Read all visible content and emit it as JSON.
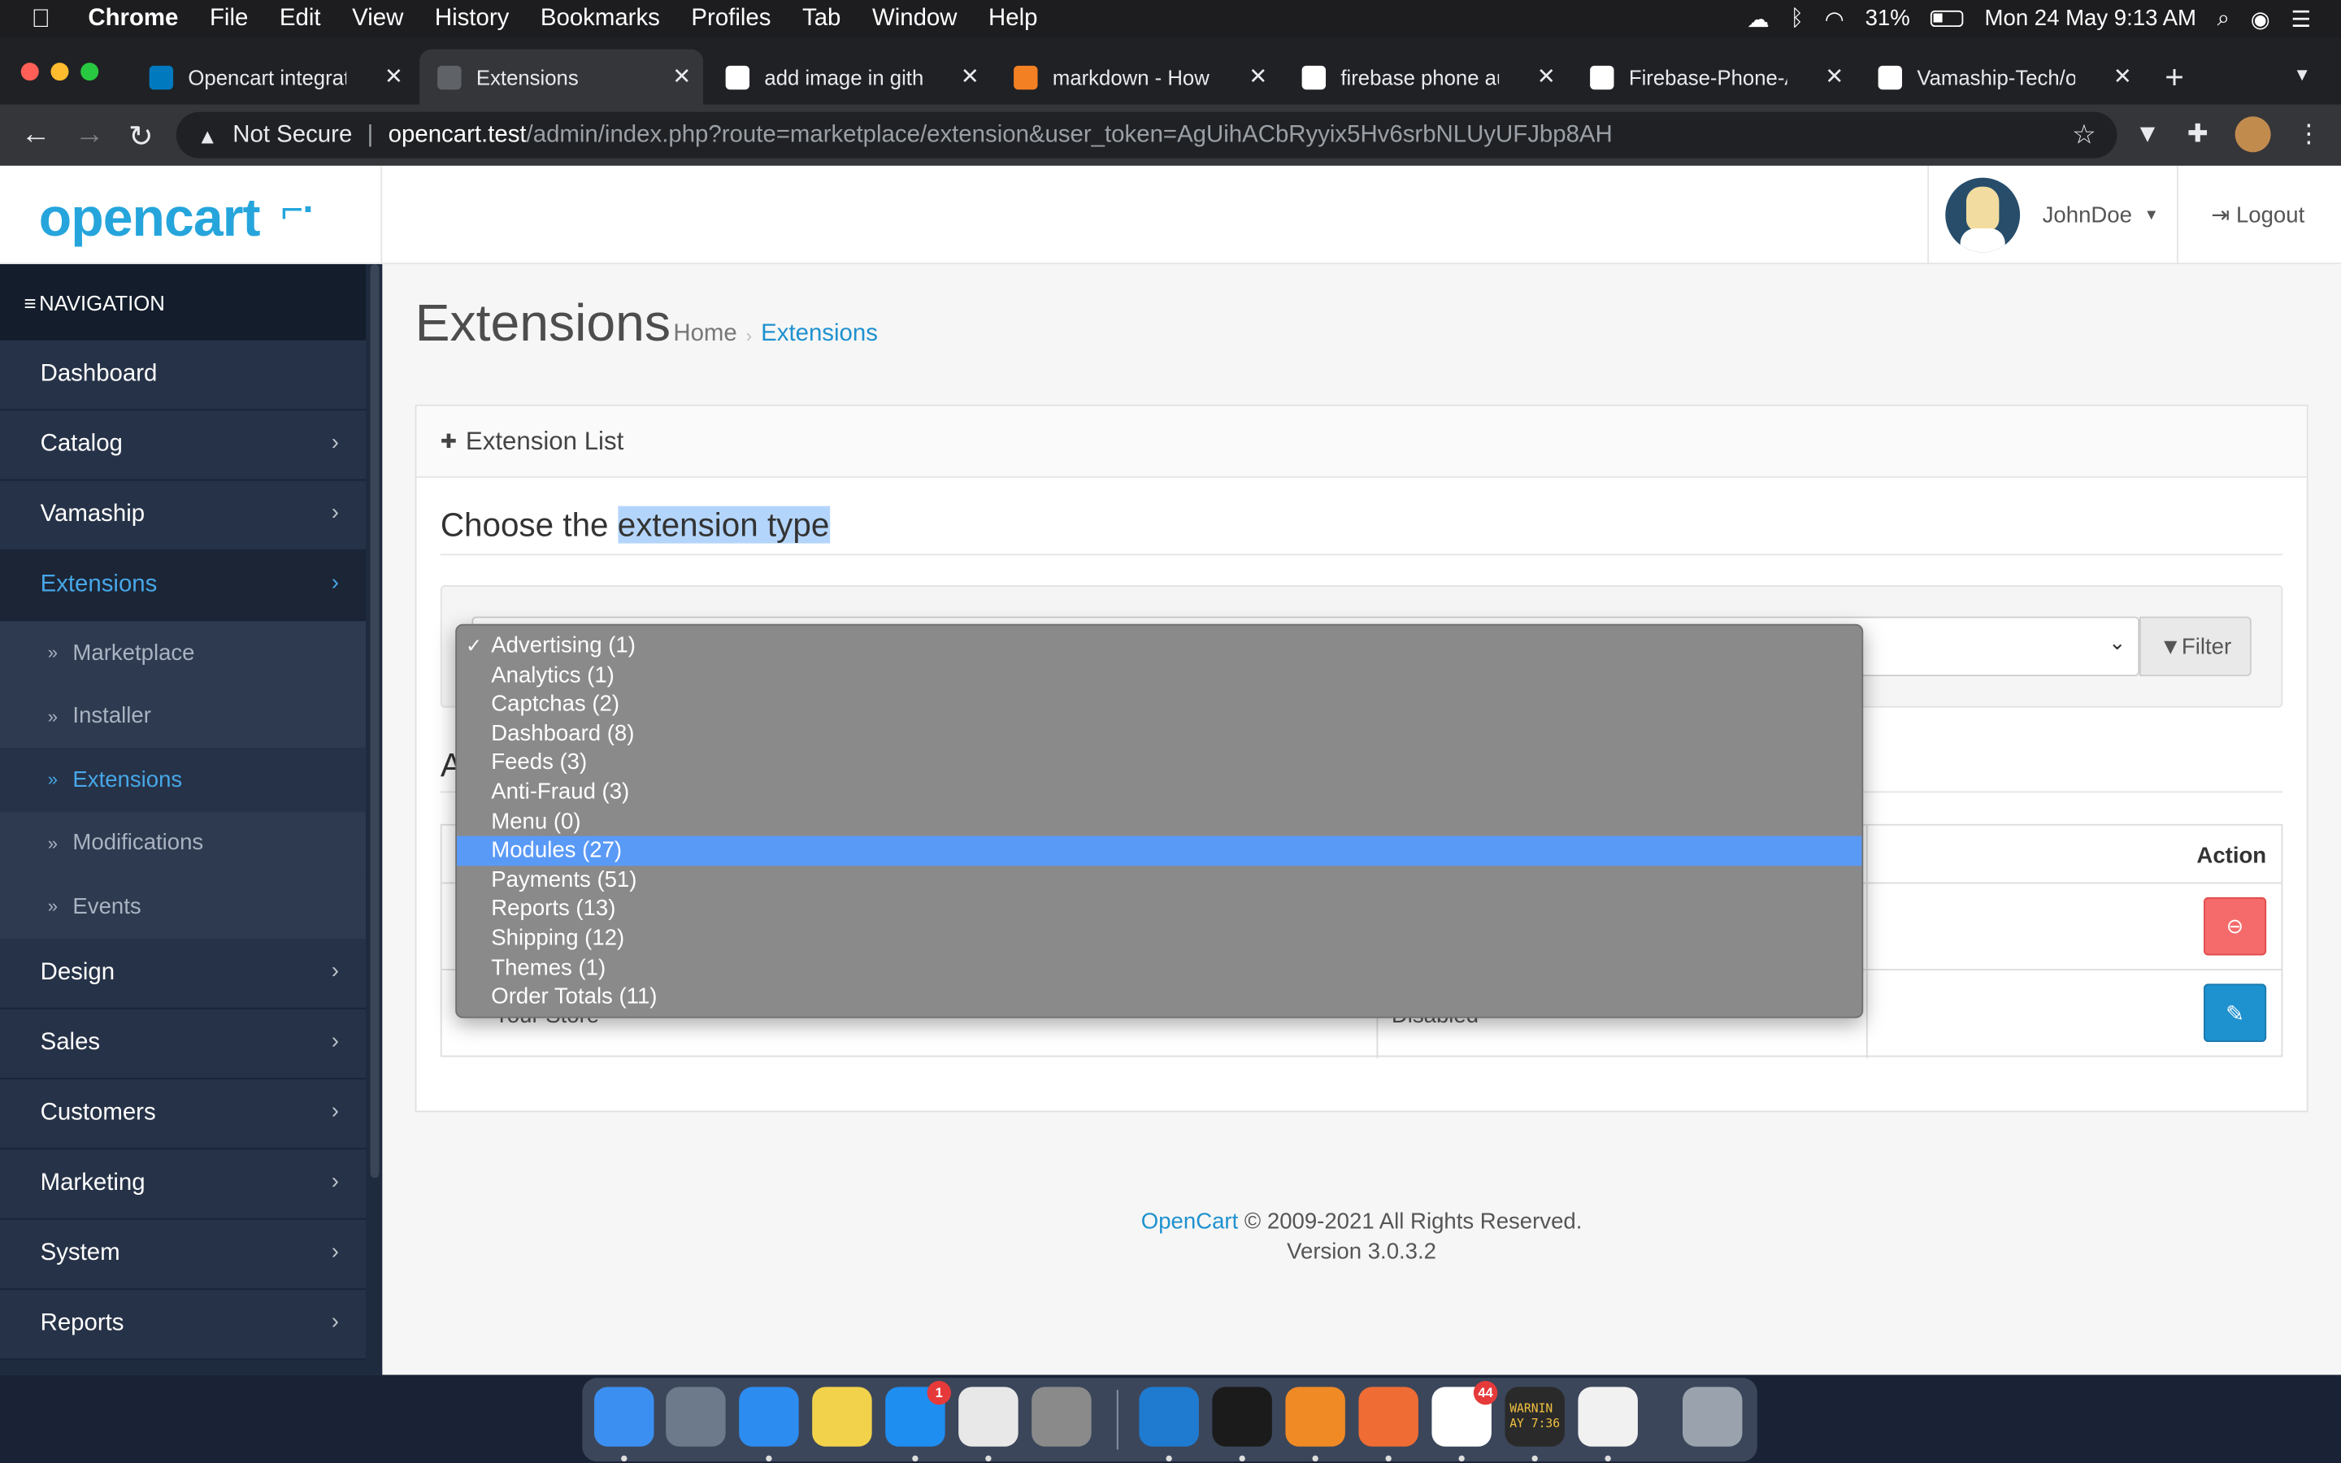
{
  "menubar": {
    "app": "Chrome",
    "menus": [
      "File",
      "Edit",
      "View",
      "History",
      "Bookmarks",
      "Profiles",
      "Tab",
      "Window",
      "Help"
    ],
    "battery": "31%",
    "clock": "Mon 24 May  9:13 AM"
  },
  "tabs": [
    {
      "title": "Opencart integratio",
      "favicon": "trello-icon",
      "color": "#0079bf"
    },
    {
      "title": "Extensions",
      "favicon": "globe-icon",
      "color": "#5f6368"
    },
    {
      "title": "add image in github",
      "favicon": "google-icon",
      "color": "#ffffff"
    },
    {
      "title": "markdown - How to",
      "favicon": "stackoverflow-icon",
      "color": "#f48024"
    },
    {
      "title": "firebase phone auth",
      "favicon": "google-icon",
      "color": "#ffffff"
    },
    {
      "title": "Firebase-Phone-Au",
      "favicon": "github-icon",
      "color": "#ffffff"
    },
    {
      "title": "Vamaship-Tech/ope",
      "favicon": "github-icon",
      "color": "#ffffff"
    }
  ],
  "address": {
    "security": "Not Secure",
    "host": "opencart.test",
    "path": "/admin/index.php?route=marketplace/extension&user_token=AgUihACbRyyix5Hv6srbNLUyUFJbp8AH"
  },
  "header": {
    "logo": "opencart",
    "user_name": "JohnDoe",
    "logout": "Logout"
  },
  "sidebar": {
    "heading": "NAVIGATION",
    "items_top": [
      {
        "label": "Dashboard",
        "chevron": false
      },
      {
        "label": "Catalog",
        "chevron": true
      },
      {
        "label": "Vamaship",
        "chevron": true
      },
      {
        "label": "Extensions",
        "chevron": true,
        "active": true
      }
    ],
    "sub_items": [
      {
        "label": "Marketplace"
      },
      {
        "label": "Installer"
      },
      {
        "label": "Extensions",
        "active": true
      },
      {
        "label": "Modifications"
      },
      {
        "label": "Events"
      }
    ],
    "items_bottom": [
      {
        "label": "Design"
      },
      {
        "label": "Sales"
      },
      {
        "label": "Customers"
      },
      {
        "label": "Marketing"
      },
      {
        "label": "System"
      },
      {
        "label": "Reports"
      }
    ]
  },
  "content": {
    "title": "Extensions",
    "breadcrumb_home": "Home",
    "breadcrumb_current": "Extensions",
    "panel_title": "Extension List",
    "choose_prefix": "Choose the ",
    "choose_highlight": "extension type",
    "filter_label": "Filter",
    "sub_heading": "A",
    "col_action": "Action",
    "row2_name": "Your Store",
    "row2_status": "Disabled"
  },
  "dropdown": {
    "checked_index": 0,
    "selected_index": 7,
    "options": [
      "Advertising (1)",
      "Analytics (1)",
      "Captchas (2)",
      "Dashboard (8)",
      "Feeds (3)",
      "Anti-Fraud (3)",
      "Menu (0)",
      "Modules (27)",
      "Payments (51)",
      "Reports (13)",
      "Shipping (12)",
      "Themes (1)",
      "Order Totals (11)"
    ]
  },
  "footer": {
    "brand": "OpenCart",
    "copyright": " © 2009-2021 All Rights Reserved.",
    "version": "Version 3.0.3.2"
  },
  "dock": {
    "apps": [
      {
        "name": "finder-icon",
        "color": "#3b8ff0"
      },
      {
        "name": "launchpad-icon",
        "color": "#6c7a8c"
      },
      {
        "name": "safari-icon",
        "color": "#2c8cf0"
      },
      {
        "name": "notes-icon",
        "color": "#f2d24b"
      },
      {
        "name": "app-store-icon",
        "color": "#1f8ef1",
        "badge": "1"
      },
      {
        "name": "chrome-icon",
        "color": "#e8e8e8"
      },
      {
        "name": "system-preferences-icon",
        "color": "#8a8a8a"
      },
      {
        "name": "vscode-icon",
        "color": "#1f7bd0"
      },
      {
        "name": "terminal-icon",
        "color": "#1b1b1b"
      },
      {
        "name": "sublime-icon",
        "color": "#f08a24"
      },
      {
        "name": "postman-icon",
        "color": "#ef6c35"
      },
      {
        "name": "slack-icon",
        "color": "#ffffff",
        "badge": "44"
      },
      {
        "name": "console-icon",
        "color": "#2a2a2a"
      },
      {
        "name": "document-icon",
        "color": "#f1f1f1"
      },
      {
        "name": "trash-icon",
        "color": "#9aa2ad"
      }
    ],
    "console_text": "WARNIN\nAY 7:36"
  }
}
